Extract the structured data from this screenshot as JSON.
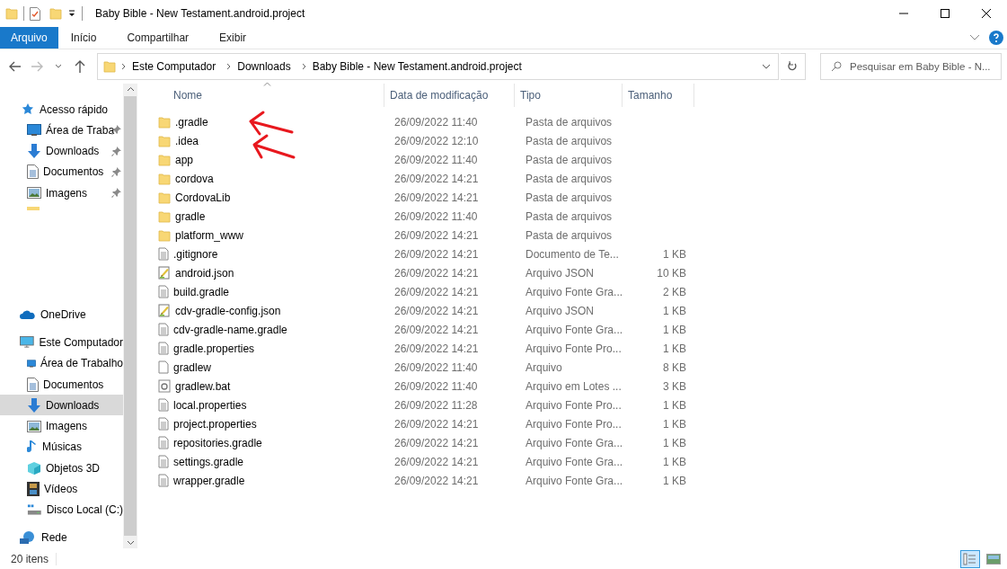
{
  "window": {
    "title": "Baby Bible - New Testament.android.project"
  },
  "ribbon_tabs": [
    {
      "label": "Arquivo",
      "selected": true
    },
    {
      "label": "Início",
      "selected": false
    },
    {
      "label": "Compartilhar",
      "selected": false
    },
    {
      "label": "Exibir",
      "selected": false
    }
  ],
  "breadcrumbs": [
    "Este Computador",
    "Downloads",
    "Baby Bible - New Testament.android.project"
  ],
  "search": {
    "placeholder": "Pesquisar em Baby Bible - N..."
  },
  "sidebar": {
    "sections": [
      {
        "label": "Acesso rápido",
        "children": [
          {
            "label": "Área de Traba",
            "pinned": true,
            "selected": false
          },
          {
            "label": "Downloads",
            "pinned": true,
            "selected": false
          },
          {
            "label": "Documentos",
            "pinned": true,
            "selected": false
          },
          {
            "label": "Imagens",
            "pinned": true,
            "selected": false
          }
        ]
      },
      {
        "label": "OneDrive"
      },
      {
        "label": "Este Computador",
        "children": [
          {
            "label": "Área de Trabalho",
            "pinned": false,
            "selected": false
          },
          {
            "label": "Documentos",
            "pinned": false,
            "selected": false
          },
          {
            "label": "Downloads",
            "pinned": false,
            "selected": true
          },
          {
            "label": "Imagens",
            "pinned": false,
            "selected": false
          },
          {
            "label": "Músicas",
            "pinned": false,
            "selected": false
          },
          {
            "label": "Objetos 3D",
            "pinned": false,
            "selected": false
          },
          {
            "label": "Vídeos",
            "pinned": false,
            "selected": false
          },
          {
            "label": "Disco Local (C:)",
            "pinned": false,
            "selected": false
          }
        ]
      },
      {
        "label": "Rede"
      }
    ]
  },
  "table": {
    "columns": [
      "Nome",
      "Data de modificação",
      "Tipo",
      "Tamanho"
    ],
    "rows": [
      {
        "name": ".gradle",
        "kind": "folder",
        "date": "26/09/2022 11:40",
        "type": "Pasta de arquivos"
      },
      {
        "name": ".idea",
        "kind": "folder",
        "date": "26/09/2022 12:10",
        "type": "Pasta de arquivos"
      },
      {
        "name": "app",
        "kind": "folder",
        "date": "26/09/2022 11:40",
        "type": "Pasta de arquivos"
      },
      {
        "name": "cordova",
        "kind": "folder",
        "date": "26/09/2022 14:21",
        "type": "Pasta de arquivos"
      },
      {
        "name": "CordovaLib",
        "kind": "folder",
        "date": "26/09/2022 14:21",
        "type": "Pasta de arquivos"
      },
      {
        "name": "gradle",
        "kind": "folder",
        "date": "26/09/2022 11:40",
        "type": "Pasta de arquivos"
      },
      {
        "name": "platform_www",
        "kind": "folder",
        "date": "26/09/2022 14:21",
        "type": "Pasta de arquivos"
      },
      {
        "name": ".gitignore",
        "kind": "text",
        "date": "26/09/2022 14:21",
        "type": "Documento de Te...",
        "size": "1 KB"
      },
      {
        "name": "android.json",
        "kind": "json",
        "date": "26/09/2022 14:21",
        "type": "Arquivo JSON",
        "size": "10 KB"
      },
      {
        "name": "build.gradle",
        "kind": "text",
        "date": "26/09/2022 14:21",
        "type": "Arquivo Fonte Gra...",
        "size": "2 KB"
      },
      {
        "name": "cdv-gradle-config.json",
        "kind": "json",
        "date": "26/09/2022 14:21",
        "type": "Arquivo JSON",
        "size": "1 KB"
      },
      {
        "name": "cdv-gradle-name.gradle",
        "kind": "text",
        "date": "26/09/2022 14:21",
        "type": "Arquivo Fonte Gra...",
        "size": "1 KB"
      },
      {
        "name": "gradle.properties",
        "kind": "text",
        "date": "26/09/2022 14:21",
        "type": "Arquivo Fonte Pro...",
        "size": "1 KB"
      },
      {
        "name": "gradlew",
        "kind": "blank",
        "date": "26/09/2022 11:40",
        "type": "Arquivo",
        "size": "8 KB"
      },
      {
        "name": "gradlew.bat",
        "kind": "bat",
        "date": "26/09/2022 11:40",
        "type": "Arquivo em Lotes ...",
        "size": "3 KB"
      },
      {
        "name": "local.properties",
        "kind": "text",
        "date": "26/09/2022 11:28",
        "type": "Arquivo Fonte Pro...",
        "size": "1 KB"
      },
      {
        "name": "project.properties",
        "kind": "text",
        "date": "26/09/2022 14:21",
        "type": "Arquivo Fonte Pro...",
        "size": "1 KB"
      },
      {
        "name": "repositories.gradle",
        "kind": "text",
        "date": "26/09/2022 14:21",
        "type": "Arquivo Fonte Gra...",
        "size": "1 KB"
      },
      {
        "name": "settings.gradle",
        "kind": "text",
        "date": "26/09/2022 14:21",
        "type": "Arquivo Fonte Gra...",
        "size": "1 KB"
      },
      {
        "name": "wrapper.gradle",
        "kind": "text",
        "date": "26/09/2022 14:21",
        "type": "Arquivo Fonte Gra...",
        "size": "1 KB"
      }
    ]
  },
  "status_bar": {
    "count": "20 itens"
  },
  "view_buttons": [
    {
      "kind": "details",
      "selected": true
    },
    {
      "kind": "thumbnails",
      "selected": false
    }
  ]
}
